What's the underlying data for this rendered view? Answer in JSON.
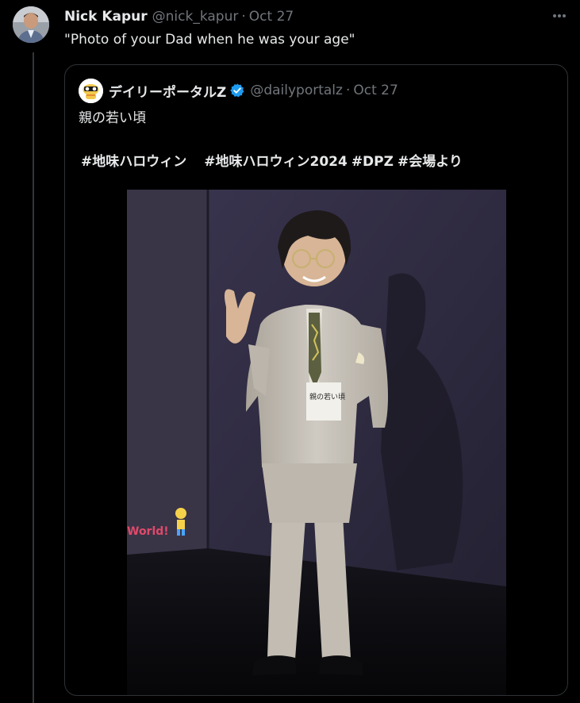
{
  "tweet": {
    "display_name": "Nick Kapur",
    "handle": "@nick_kapur",
    "separator": "·",
    "date": "Oct 27",
    "text": "\"Photo of your Dad when he was your age\"",
    "avatar_icon": "user-avatar",
    "more_icon": "more-horizontal-icon"
  },
  "quote": {
    "display_name": "デイリーポータルZ",
    "handle": "@dailyportalz",
    "separator": "·",
    "date": "Oct 27",
    "text": "親の若い頃",
    "hashtags": [
      "#地味ハロウィン",
      "#地味ハロウィン2024",
      "#DPZ",
      "#会場より"
    ],
    "verified_icon": "verified-badge-icon",
    "photo": {
      "badge_text": "親の若い頃",
      "stage_sign": "World!"
    }
  },
  "colors": {
    "background": "#000000",
    "text_primary": "#e7e9ea",
    "text_secondary": "#71767b",
    "border": "#2f3336",
    "verified": "#1d9bf0"
  }
}
